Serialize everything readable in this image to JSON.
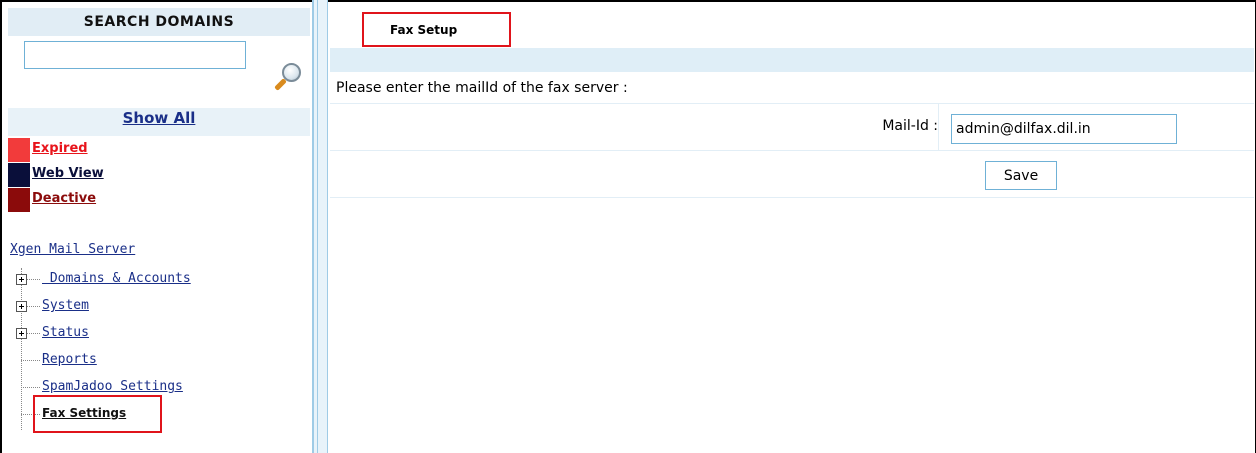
{
  "sidebar": {
    "search_header": "SEARCH DOMAINS",
    "search_value": "",
    "search_icon": "magnifier-icon",
    "show_all": "Show All",
    "legend": [
      {
        "label": "Expired",
        "color": "#f23b3b",
        "text_color": "#e8141b"
      },
      {
        "label": "Web View",
        "color": "#0a0f3a",
        "text_color": "#0a0f3a"
      },
      {
        "label": "Deactive",
        "color": "#8b0b0b",
        "text_color": "#8b0b0b"
      }
    ],
    "tree": {
      "root": "Xgen Mail Server",
      "items": [
        {
          "label": " Domains & Accounts",
          "expandable": true
        },
        {
          "label": "System",
          "expandable": true
        },
        {
          "label": "Status",
          "expandable": true
        },
        {
          "label": "Reports",
          "expandable": false
        },
        {
          "label": "SpamJadoo Settings",
          "expandable": false
        },
        {
          "label": "Fax Settings",
          "expandable": false,
          "selected": true
        }
      ]
    }
  },
  "main": {
    "tab_title": "Fax Setup",
    "prompt": "Please enter the mailId of the fax server :",
    "mailid_label": "Mail-Id :",
    "mailid_value": "admin@dilfax.dil.in",
    "save_label": "Save"
  },
  "colors": {
    "highlight_red": "#e0141b",
    "link_blue": "#1a2f88",
    "panel_blue": "#dfeef7"
  }
}
